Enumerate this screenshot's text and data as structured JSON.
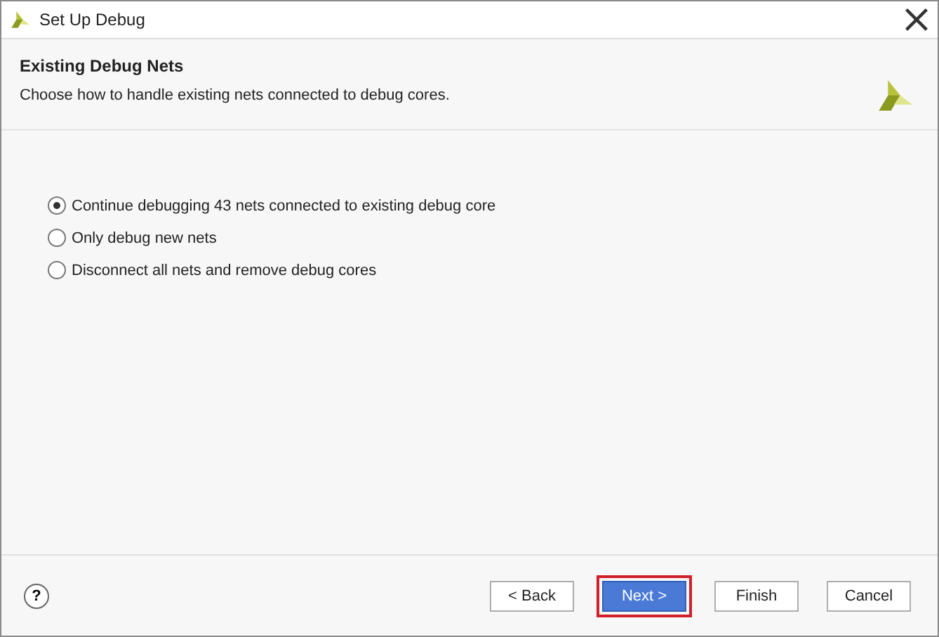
{
  "window": {
    "title": "Set Up Debug"
  },
  "header": {
    "title": "Existing Debug Nets",
    "subtitle": "Choose how to handle existing nets connected to debug cores."
  },
  "options": [
    {
      "label": "Continue debugging 43 nets connected to existing debug core",
      "selected": true
    },
    {
      "label": "Only debug new nets",
      "selected": false
    },
    {
      "label": "Disconnect all nets and remove debug cores",
      "selected": false
    }
  ],
  "help": {
    "label": "?"
  },
  "buttons": [
    {
      "label": "< Back",
      "primary": false,
      "highlighted": false
    },
    {
      "label": "Next >",
      "primary": true,
      "highlighted": true
    },
    {
      "label": "Finish",
      "primary": false,
      "highlighted": false
    },
    {
      "label": "Cancel",
      "primary": false,
      "highlighted": false
    }
  ]
}
